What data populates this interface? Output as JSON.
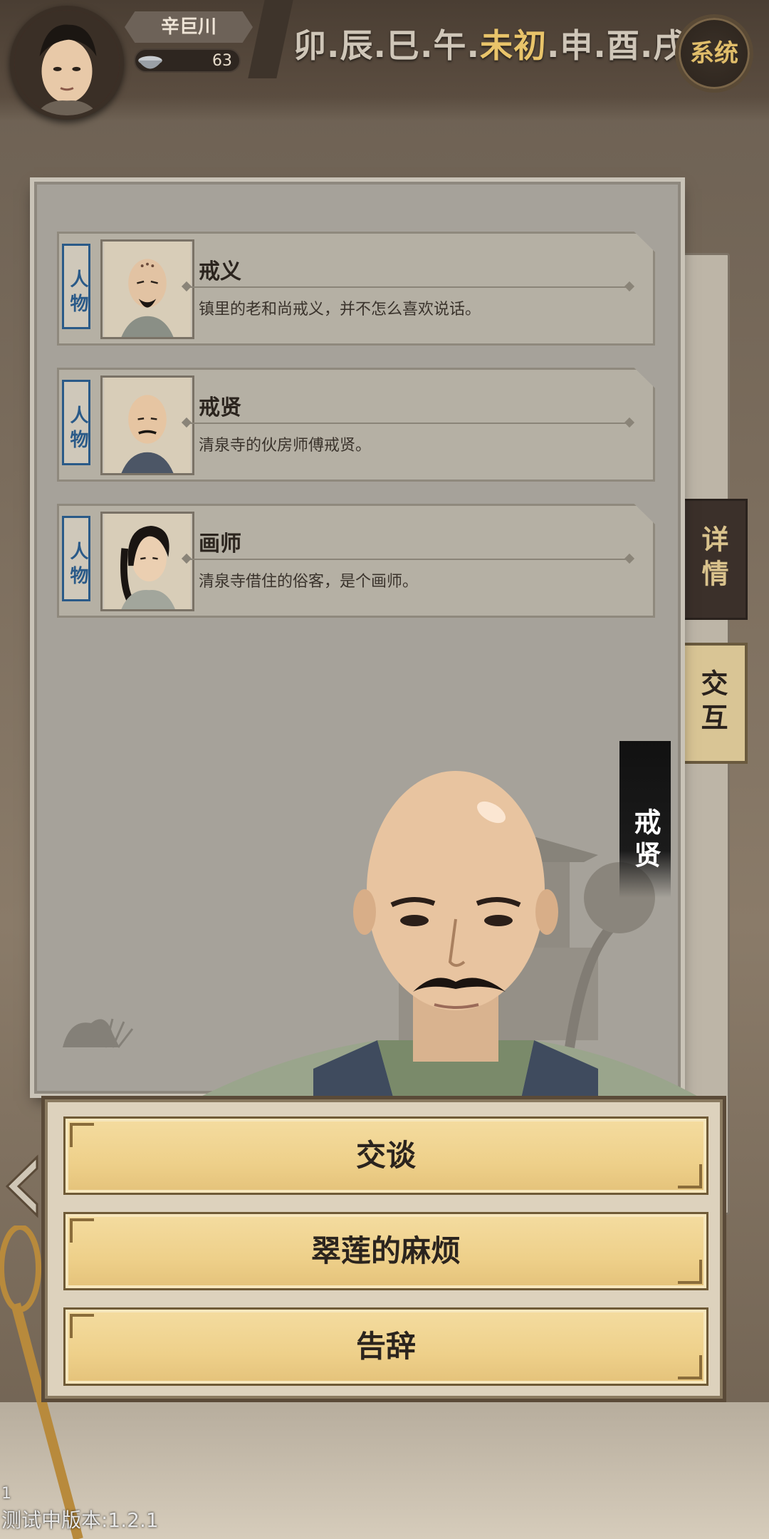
{
  "player": {
    "name": "辛巨川",
    "coins": "63"
  },
  "time_bar": {
    "before": [
      "卯",
      "辰",
      "巳",
      "午"
    ],
    "current": "未初",
    "after": [
      "申",
      "酉",
      "戌"
    ],
    "separator": "."
  },
  "system_button": "系统",
  "npc_list": [
    {
      "tag": "人物",
      "name": "戒义",
      "desc": "镇里的老和尚戒义，并不怎么喜欢说话。"
    },
    {
      "tag": "人物",
      "name": "戒贤",
      "desc": "清泉寺的伙房师傅戒贤。"
    },
    {
      "tag": "人物",
      "name": "画师",
      "desc": "清泉寺借住的俗客，是个画师。"
    }
  ],
  "side_tabs": {
    "detail": "详情",
    "interact": "交互"
  },
  "selected_npc": "戒贤",
  "dialog_options": [
    "交谈",
    "翠莲的麻烦",
    "告辞"
  ],
  "build_number": "1",
  "version": "测试中版本:1.2.1",
  "colors": {
    "accent_gold": "#e9c46a",
    "button_gold": "#eed08a",
    "tag_blue": "#2a5a88"
  }
}
